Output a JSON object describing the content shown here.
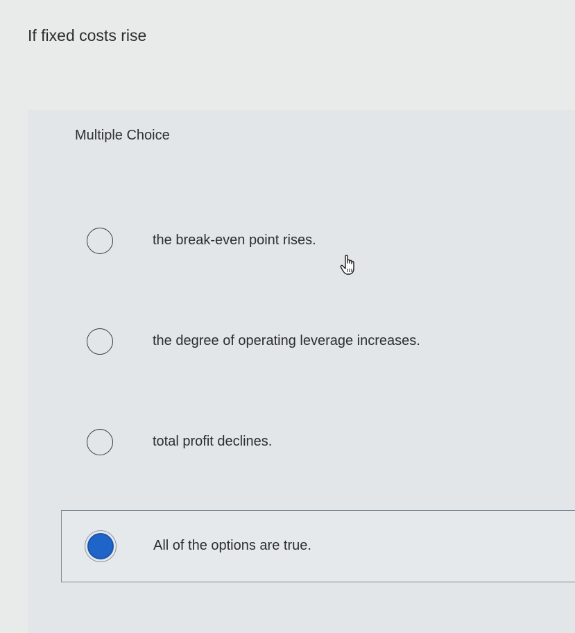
{
  "question": {
    "text": "If fixed costs rise"
  },
  "panel": {
    "header": "Multiple Choice",
    "options": [
      {
        "label": "the break-even point rises.",
        "selected": false
      },
      {
        "label": "the degree of operating leverage increases.",
        "selected": false
      },
      {
        "label": "total profit declines.",
        "selected": false
      },
      {
        "label": "All of the options are true.",
        "selected": true
      }
    ]
  },
  "colors": {
    "selected_radio": "#1f64c8",
    "panel_background": "#e2e6e8",
    "page_background": "#e9ebea"
  },
  "icons": {
    "cursor": "hand-pointer-icon"
  }
}
